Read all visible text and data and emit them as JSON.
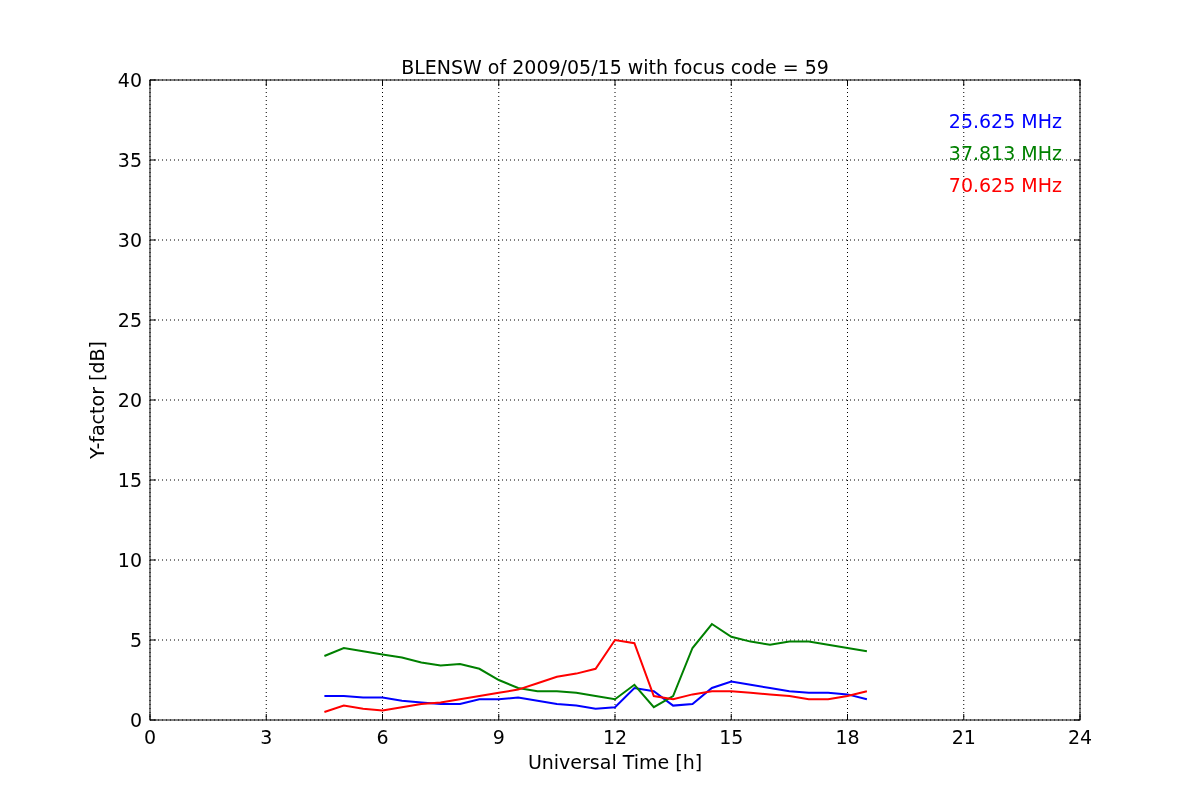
{
  "figure": {
    "chart_data": {
      "type": "line",
      "title": "BLENSW of 2009/05/15 with focus code = 59",
      "xlabel": "Universal Time [h]",
      "ylabel": "Y-factor [dB]",
      "x": [
        4.5,
        5,
        5.5,
        6,
        6.5,
        7,
        7.5,
        8,
        8.5,
        9,
        9.5,
        10,
        10.5,
        11,
        11.5,
        12,
        12.5,
        13,
        13.5,
        14,
        14.5,
        15,
        15.5,
        16,
        16.5,
        17,
        17.5,
        18,
        18.5
      ],
      "series": [
        {
          "name": "25.625 MHz",
          "color": "#0000ff",
          "values": [
            1.5,
            1.5,
            1.4,
            1.4,
            1.2,
            1.1,
            1.0,
            1.0,
            1.3,
            1.3,
            1.4,
            1.2,
            1.0,
            0.9,
            0.7,
            0.8,
            2.0,
            1.8,
            0.9,
            1.0,
            2.0,
            2.4,
            2.2,
            2.0,
            1.8,
            1.7,
            1.7,
            1.6,
            1.3
          ]
        },
        {
          "name": "37.813 MHz",
          "color": "#008000",
          "values": [
            4.0,
            4.5,
            4.3,
            4.1,
            3.9,
            3.6,
            3.4,
            3.5,
            3.2,
            2.5,
            2.0,
            1.8,
            1.8,
            1.7,
            1.5,
            1.3,
            2.2,
            0.8,
            1.5,
            4.5,
            6.0,
            5.2,
            4.9,
            4.7,
            4.9,
            4.9,
            4.7,
            4.5,
            4.3
          ]
        },
        {
          "name": "70.625 MHz",
          "color": "#ff0000",
          "values": [
            0.5,
            0.9,
            0.7,
            0.6,
            0.8,
            1.0,
            1.1,
            1.3,
            1.5,
            1.7,
            1.9,
            2.3,
            2.7,
            2.9,
            3.2,
            5.0,
            4.8,
            1.5,
            1.3,
            1.6,
            1.8,
            1.8,
            1.7,
            1.6,
            1.5,
            1.3,
            1.3,
            1.5,
            1.8
          ]
        }
      ],
      "xlim": [
        0,
        24
      ],
      "ylim": [
        0,
        40
      ],
      "xticks": [
        0,
        3,
        6,
        9,
        12,
        15,
        18,
        21,
        24
      ],
      "yticks": [
        0,
        5,
        10,
        15,
        20,
        25,
        30,
        35,
        40
      ],
      "grid": true
    }
  }
}
